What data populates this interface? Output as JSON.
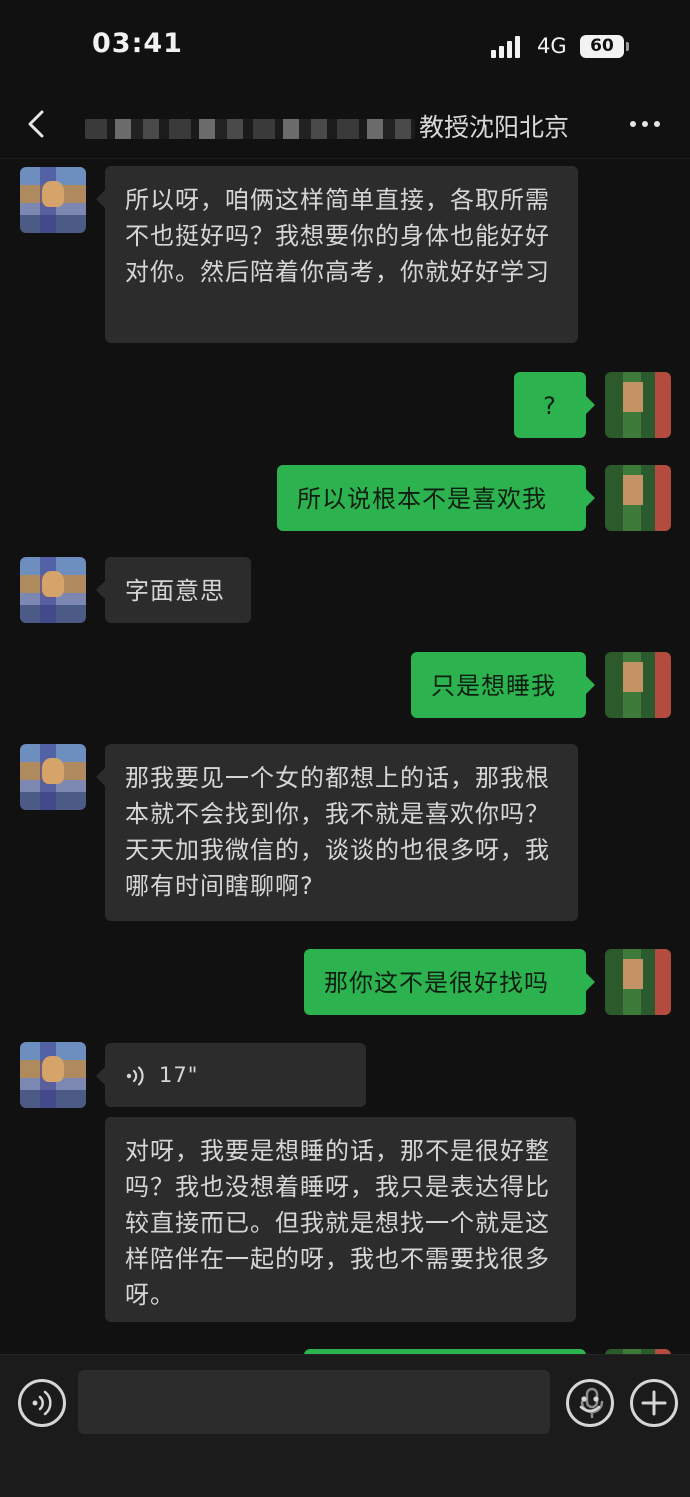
{
  "status_bar": {
    "time": "03:41",
    "network": "4G",
    "battery": "60"
  },
  "header": {
    "title_visible": "教授沈阳北京"
  },
  "messages": [
    {
      "from": "other",
      "text": "所以呀，咱俩这样简单直接，各取所需不也挺好吗？我想要你的身体也能好好对你。然后陪着你高考，你就好好学习"
    },
    {
      "from": "self",
      "text": "?"
    },
    {
      "from": "self",
      "text": "所以说根本不是喜欢我"
    },
    {
      "from": "other",
      "text": "字面意思"
    },
    {
      "from": "self",
      "text": "只是想睡我"
    },
    {
      "from": "other",
      "text": "那我要见一个女的都想上的话，那我根本就不会找到你，我不就是喜欢你吗？天天加我微信的，谈谈的也很多呀，我哪有时间瞎聊啊?"
    },
    {
      "from": "self",
      "text": "那你这不是很好找吗"
    },
    {
      "from": "other",
      "type": "voice",
      "duration": "17\""
    },
    {
      "from": "other",
      "text": "对呀，我要是想睡的话，那不是很好整吗？我也没想着睡呀，我只是表达得比较直接而已。但我就是想找一个就是这样陪伴在一起的呀，我也不需要找很多呀。"
    }
  ],
  "icons": {
    "back": "chevron-left-icon",
    "more": "more-dots-icon",
    "voice_mode": "voice-mode-icon",
    "mic": "microphone-icon",
    "emoji": "emoji-icon",
    "plus": "plus-icon"
  },
  "colors": {
    "background": "#111111",
    "incoming_bubble": "#2c2c2c",
    "outgoing_bubble": "#2cb34f"
  }
}
